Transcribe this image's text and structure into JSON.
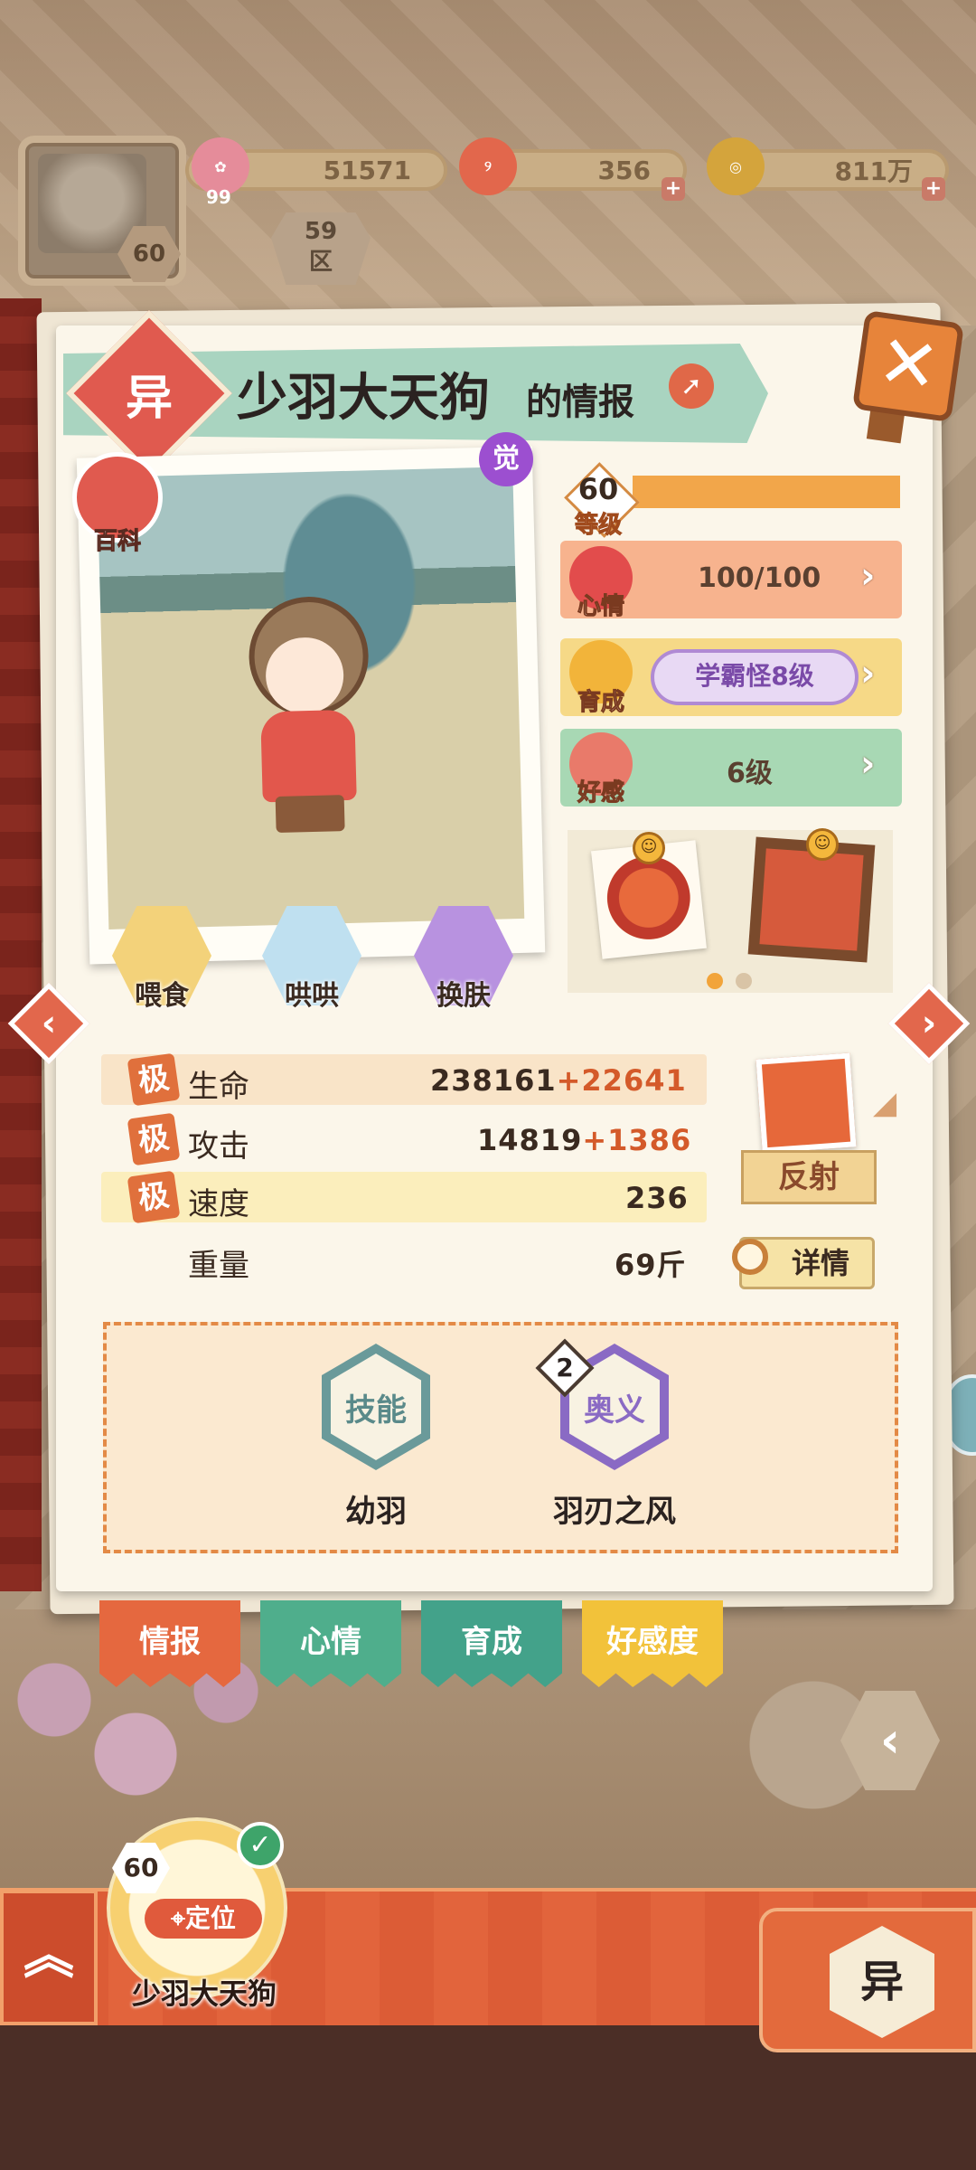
{
  "hud": {
    "player_level": "60",
    "resources": [
      {
        "icon": "sakura-flower-icon",
        "badge": "99",
        "value": "51571"
      },
      {
        "icon": "magatama-icon",
        "value": "356"
      },
      {
        "icon": "coin-icon",
        "value": "811万"
      }
    ],
    "region_number": "59",
    "region_label": "区"
  },
  "title": {
    "type_char": "异",
    "name": "少羽大天狗",
    "suffix": "的情报"
  },
  "portrait": {
    "encyclopedia_label": "百科",
    "awaken_label": "觉",
    "actions": [
      {
        "label": "喂食",
        "color": "#f3d27a"
      },
      {
        "label": "哄哄",
        "color": "#bfe0f0"
      },
      {
        "label": "换肤",
        "color": "#b892e0"
      }
    ]
  },
  "stats": {
    "level_value": "60",
    "level_label": "等级",
    "mood_label": "心情",
    "mood_value": "100/100",
    "growth_label": "育成",
    "growth_value": "学霸怪8级",
    "affection_label": "好感",
    "affection_value": "6级"
  },
  "attributes": [
    {
      "grade": "极",
      "name": "生命",
      "base": "238161",
      "bonus": "+22641"
    },
    {
      "grade": "极",
      "name": "攻击",
      "base": "14819",
      "bonus": "+1386"
    },
    {
      "grade": "极",
      "name": "速度",
      "base": "236",
      "bonus": ""
    },
    {
      "grade": "",
      "name": "重量",
      "base": "69斤",
      "bonus": ""
    }
  ],
  "trait": {
    "label": "反射",
    "detail_label": "详情"
  },
  "skills": [
    {
      "type": "技能",
      "name": "幼羽",
      "badge": ""
    },
    {
      "type": "奥义",
      "name": "羽刃之风",
      "badge": "2"
    }
  ],
  "tabs": [
    {
      "label": "情报",
      "color": "#e5683f"
    },
    {
      "label": "心情",
      "color": "#4fae8c"
    },
    {
      "label": "育成",
      "color": "#43a28a"
    },
    {
      "label": "好感度",
      "color": "#f2c23a"
    }
  ],
  "bottom": {
    "selected_level": "60",
    "locate_label": "定位",
    "selected_name": "少羽大天狗",
    "type_char": "异",
    "check_mark": "✓",
    "up_glyph": "︽"
  },
  "colors": {
    "accent_red": "#e05a4f",
    "mood_row": "#f7b38e",
    "growth_row": "#f6d987",
    "affection_row": "#a8d8b4"
  }
}
